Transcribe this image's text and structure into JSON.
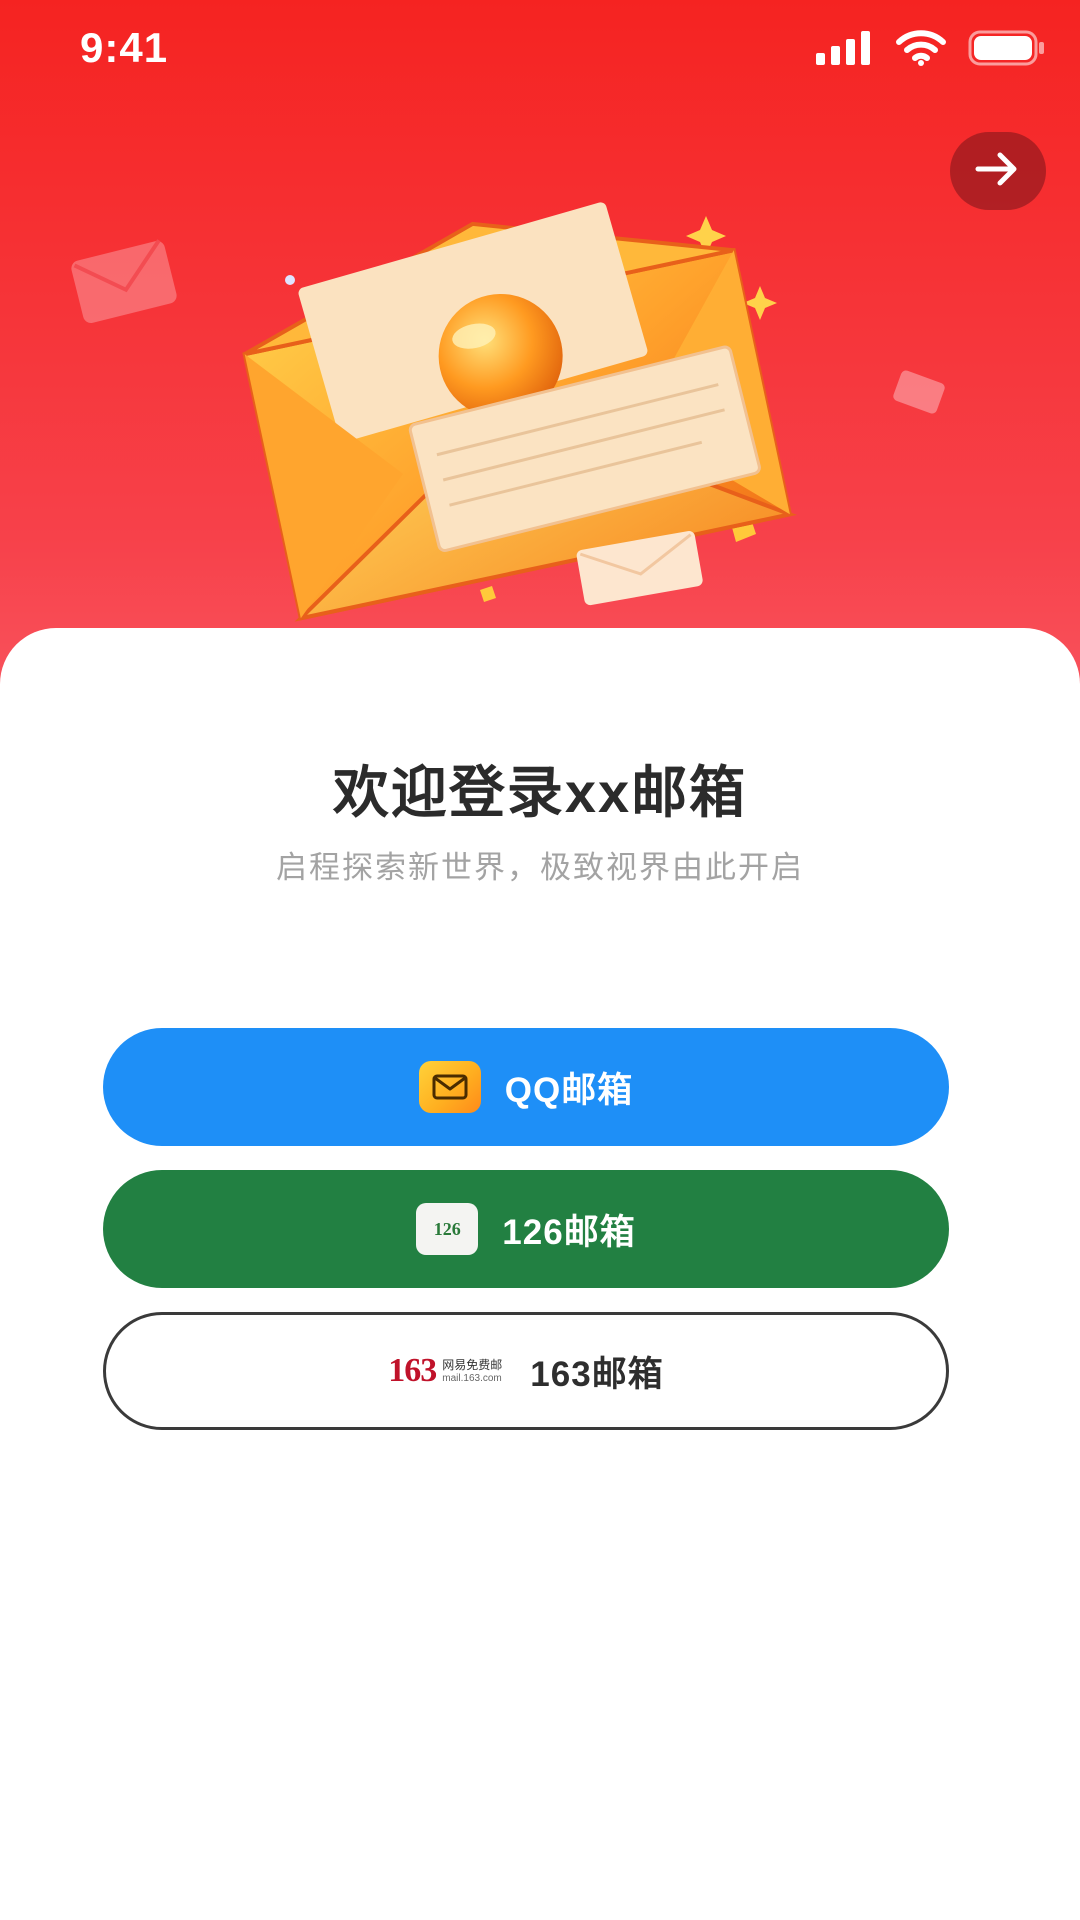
{
  "status_bar": {
    "time": "9:41",
    "icons": [
      "signal-icon",
      "wifi-icon",
      "battery-icon"
    ]
  },
  "header": {
    "skip_icon": "arrow-right-icon",
    "illustration": "envelope-illustration"
  },
  "welcome": {
    "title": "欢迎登录xx邮箱",
    "subtitle": "启程探索新世界，极致视界由此开启"
  },
  "login_options": [
    {
      "label": "QQ邮箱",
      "icon": "qq-mail-icon",
      "color": "#1e8ff7"
    },
    {
      "label": "126邮箱",
      "icon": "126-mail-icon",
      "icon_text": "126",
      "color": "#228042"
    },
    {
      "label": "163邮箱",
      "icon": "163-mail-logo",
      "logo_number": "163",
      "logo_cn": "网易免费邮",
      "logo_url": "mail.163.com",
      "color": "#ffffff"
    }
  ],
  "colors": {
    "header_top": "#f52321",
    "header_bottom": "#fdb0b8",
    "title": "#2b2b2b",
    "subtitle": "#a3a3a3"
  }
}
